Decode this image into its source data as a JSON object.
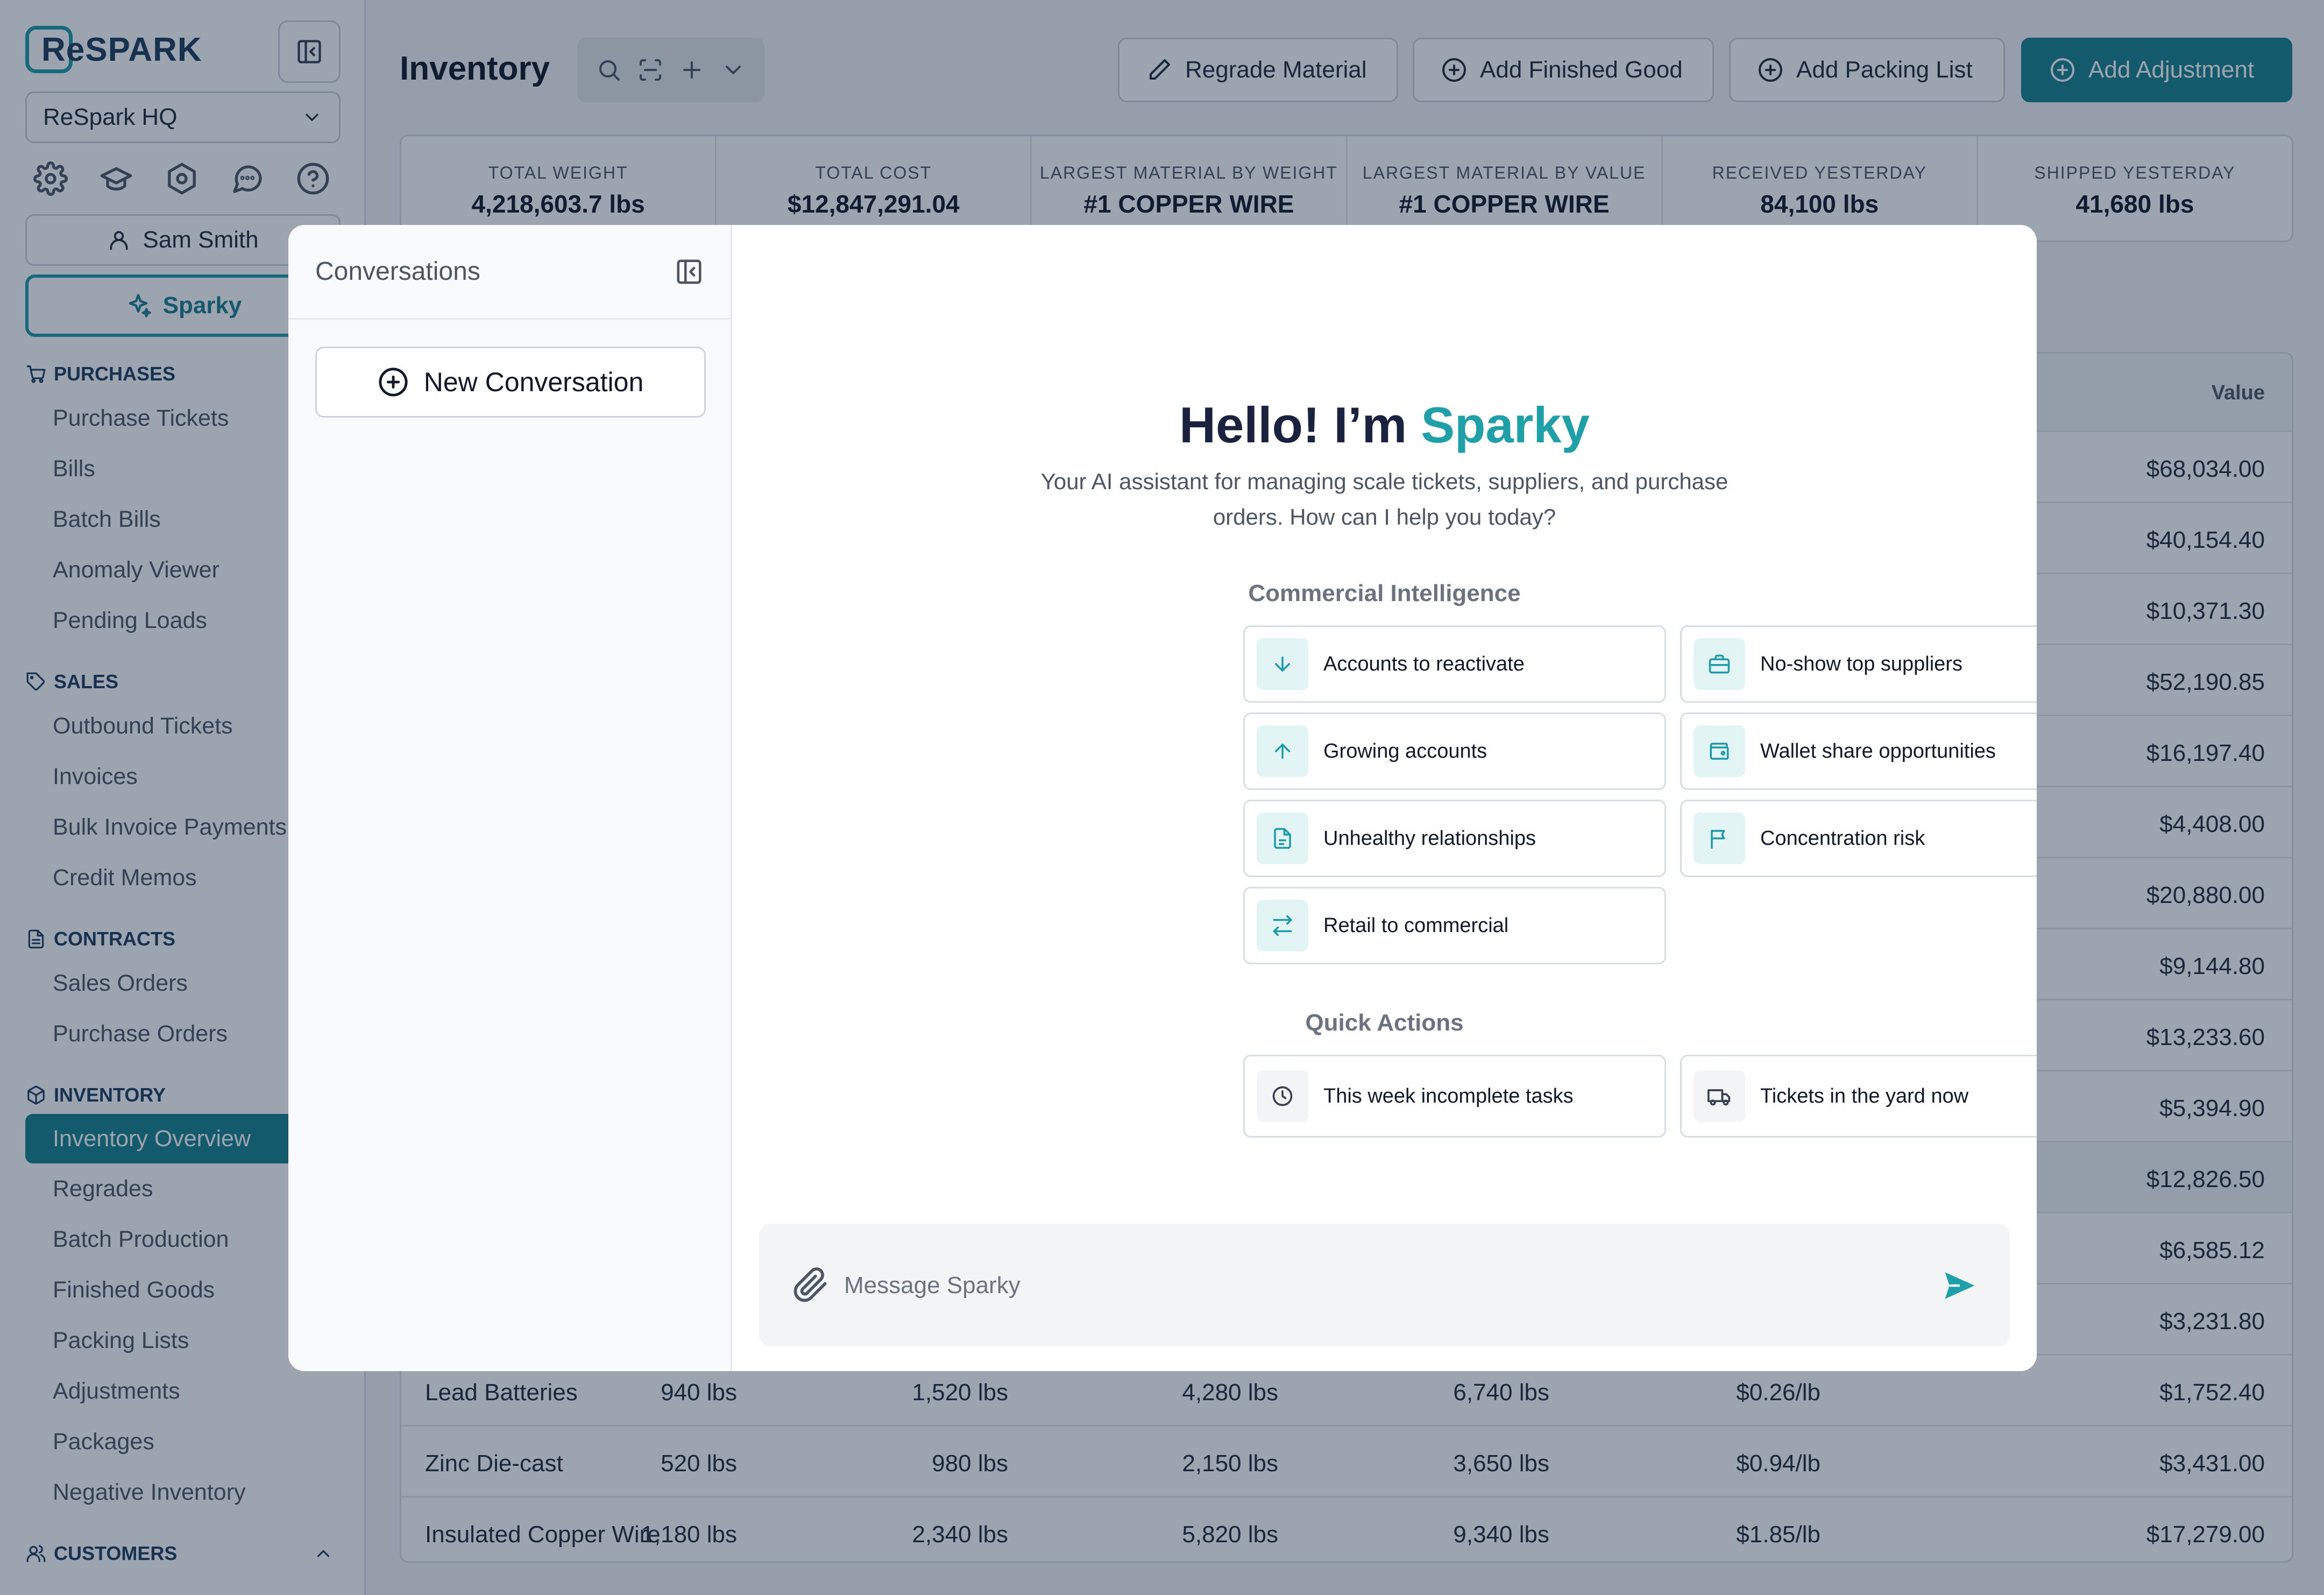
{
  "app": {
    "logo": "ReSPARK",
    "org": "ReSpark HQ",
    "user": "Sam Smith",
    "sparky_label": "Sparky"
  },
  "nav": [
    {
      "section": "PURCHASES",
      "icon": "cart-icon",
      "items": [
        "Purchase Tickets",
        "Bills",
        "Batch Bills",
        "Anomaly Viewer",
        "Pending Loads"
      ]
    },
    {
      "section": "SALES",
      "icon": "tag-icon",
      "items": [
        "Outbound Tickets",
        "Invoices",
        "Bulk Invoice Payments",
        "Credit Memos"
      ]
    },
    {
      "section": "CONTRACTS",
      "icon": "document-icon",
      "items": [
        "Sales Orders",
        "Purchase Orders"
      ]
    },
    {
      "section": "INVENTORY",
      "icon": "box-icon",
      "items": [
        "Inventory Overview",
        "Regrades",
        "Batch Production",
        "Finished Goods",
        "Packing Lists",
        "Adjustments",
        "Packages",
        "Negative Inventory"
      ],
      "active": "Inventory Overview"
    },
    {
      "section": "CUSTOMERS",
      "icon": "users-icon",
      "items": []
    }
  ],
  "header": {
    "title": "Inventory",
    "buttons": {
      "regrade": "Regrade Material",
      "finished": "Add Finished Good",
      "packing": "Add Packing List",
      "adjustment": "Add Adjustment"
    }
  },
  "stats": [
    {
      "label": "TOTAL WEIGHT",
      "value": "4,218,603.7 lbs"
    },
    {
      "label": "TOTAL COST",
      "value": "$12,847,291.04"
    },
    {
      "label": "LARGEST MATERIAL BY WEIGHT",
      "value": "#1 COPPER WIRE"
    },
    {
      "label": "LARGEST MATERIAL BY VALUE",
      "value": "#1 COPPER WIRE"
    },
    {
      "label": "RECEIVED YESTERDAY",
      "value": "84,100 lbs"
    },
    {
      "label": "SHIPPED YESTERDAY",
      "value": "41,680 lbs"
    }
  ],
  "table": {
    "value_header": "Value",
    "rows": [
      [
        "",
        "",
        "",
        "",
        "",
        "",
        "$68,034.00"
      ],
      [
        "",
        "",
        "",
        "",
        "",
        "",
        "$40,154.40"
      ],
      [
        "",
        "",
        "",
        "",
        "",
        "",
        "$10,371.30"
      ],
      [
        "",
        "",
        "",
        "",
        "",
        "",
        "$52,190.85"
      ],
      [
        "",
        "",
        "",
        "",
        "",
        "",
        "$16,197.40"
      ],
      [
        "",
        "",
        "",
        "",
        "",
        "",
        "$4,408.00"
      ],
      [
        "",
        "",
        "",
        "",
        "",
        "",
        "$20,880.00"
      ],
      [
        "",
        "",
        "",
        "",
        "",
        "",
        "$9,144.80"
      ],
      [
        "",
        "",
        "",
        "",
        "",
        "",
        "$13,233.60"
      ],
      [
        "",
        "",
        "",
        "",
        "",
        "",
        "$5,394.90"
      ],
      [
        "",
        "",
        "",
        "",
        "",
        "",
        "$12,826.50"
      ],
      [
        "",
        "",
        "",
        "",
        "",
        "",
        "$6,585.12"
      ],
      [
        "",
        "",
        "",
        "",
        "",
        "",
        "$3,231.80"
      ],
      [
        "Lead Batteries",
        "940 lbs",
        "1,520 lbs",
        "4,280 lbs",
        "6,740 lbs",
        "$0.26/lb",
        "$1,752.40"
      ],
      [
        "Zinc Die-cast",
        "520 lbs",
        "980 lbs",
        "2,150 lbs",
        "3,650 lbs",
        "$0.94/lb",
        "$3,431.00"
      ],
      [
        "Insulated Copper Wire",
        "1,180 lbs",
        "2,340 lbs",
        "5,820 lbs",
        "9,340 lbs",
        "$1.85/lb",
        "$17,279.00"
      ]
    ]
  },
  "modal": {
    "conversations_title": "Conversations",
    "new_conversation": "New Conversation",
    "greeting": "Hello! I’m ",
    "greeting_name": "Sparky",
    "subtitle": "Your AI assistant for managing scale tickets, suppliers, and purchase orders. How can I help you today?",
    "commercial_title": "Commercial Intelligence",
    "commercial": [
      {
        "label": "Accounts to reactivate",
        "icon": "arrow-down-icon"
      },
      {
        "label": "No-show top suppliers",
        "icon": "briefcase-icon"
      },
      {
        "label": "Growing accounts",
        "icon": "arrow-up-icon"
      },
      {
        "label": "Wallet share opportunities",
        "icon": "wallet-icon"
      },
      {
        "label": "Unhealthy relationships",
        "icon": "file-alert-icon"
      },
      {
        "label": "Concentration risk",
        "icon": "flag-icon"
      },
      {
        "label": "Retail to commercial",
        "icon": "swap-arrows-icon"
      }
    ],
    "quick_title": "Quick Actions",
    "quick": [
      {
        "label": "This week incomplete tasks",
        "icon": "clock-icon"
      },
      {
        "label": "Tickets in the yard now",
        "icon": "truck-icon"
      }
    ],
    "message_placeholder": "Message Sparky"
  }
}
